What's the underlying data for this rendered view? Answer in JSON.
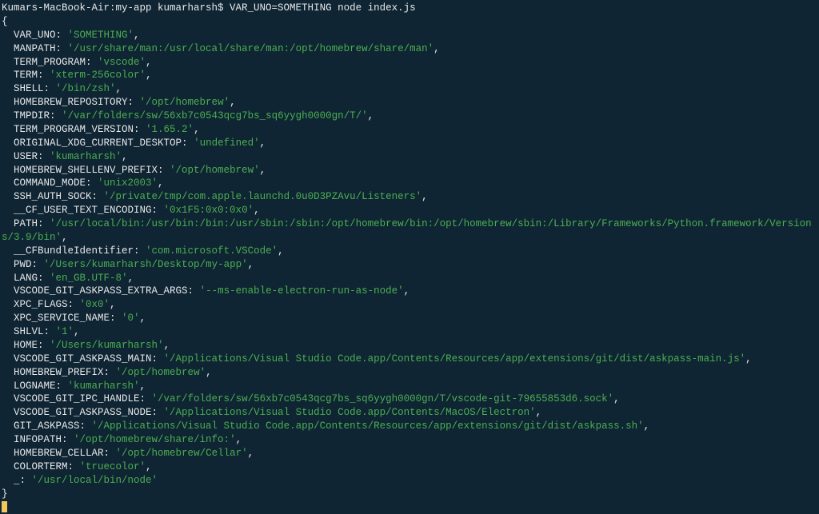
{
  "prompt": "Kumars-MacBook-Air:my-app kumarharsh$ VAR_UNO=SOMETHING node index.js",
  "open_brace": "{",
  "close_brace": "}",
  "env": [
    {
      "key": "VAR_UNO",
      "value": "'SOMETHING'",
      "comma": true
    },
    {
      "key": "MANPATH",
      "value": "'/usr/share/man:/usr/local/share/man:/opt/homebrew/share/man'",
      "comma": true
    },
    {
      "key": "TERM_PROGRAM",
      "value": "'vscode'",
      "comma": true
    },
    {
      "key": "TERM",
      "value": "'xterm-256color'",
      "comma": true
    },
    {
      "key": "SHELL",
      "value": "'/bin/zsh'",
      "comma": true
    },
    {
      "key": "HOMEBREW_REPOSITORY",
      "value": "'/opt/homebrew'",
      "comma": true
    },
    {
      "key": "TMPDIR",
      "value": "'/var/folders/sw/56xb7c0543qcg7bs_sq6yygh0000gn/T/'",
      "comma": true
    },
    {
      "key": "TERM_PROGRAM_VERSION",
      "value": "'1.65.2'",
      "comma": true
    },
    {
      "key": "ORIGINAL_XDG_CURRENT_DESKTOP",
      "value": "'undefined'",
      "comma": true
    },
    {
      "key": "USER",
      "value": "'kumarharsh'",
      "comma": true
    },
    {
      "key": "HOMEBREW_SHELLENV_PREFIX",
      "value": "'/opt/homebrew'",
      "comma": true
    },
    {
      "key": "COMMAND_MODE",
      "value": "'unix2003'",
      "comma": true
    },
    {
      "key": "SSH_AUTH_SOCK",
      "value": "'/private/tmp/com.apple.launchd.0u0D3PZAvu/Listeners'",
      "comma": true
    },
    {
      "key": "__CF_USER_TEXT_ENCODING",
      "value": "'0x1F5:0x0:0x0'",
      "comma": true
    },
    {
      "key": "PATH",
      "value": "'/usr/local/bin:/usr/bin:/bin:/usr/sbin:/sbin:/opt/homebrew/bin:/opt/homebrew/sbin:/Library/Frameworks/Python.framework/Versions/3.9/bin'",
      "comma": true
    },
    {
      "key": "__CFBundleIdentifier",
      "value": "'com.microsoft.VSCode'",
      "comma": true
    },
    {
      "key": "PWD",
      "value": "'/Users/kumarharsh/Desktop/my-app'",
      "comma": true
    },
    {
      "key": "LANG",
      "value": "'en_GB.UTF-8'",
      "comma": true
    },
    {
      "key": "VSCODE_GIT_ASKPASS_EXTRA_ARGS",
      "value": "'--ms-enable-electron-run-as-node'",
      "comma": true
    },
    {
      "key": "XPC_FLAGS",
      "value": "'0x0'",
      "comma": true
    },
    {
      "key": "XPC_SERVICE_NAME",
      "value": "'0'",
      "comma": true
    },
    {
      "key": "SHLVL",
      "value": "'1'",
      "comma": true
    },
    {
      "key": "HOME",
      "value": "'/Users/kumarharsh'",
      "comma": true
    },
    {
      "key": "VSCODE_GIT_ASKPASS_MAIN",
      "value": "'/Applications/Visual Studio Code.app/Contents/Resources/app/extensions/git/dist/askpass-main.js'",
      "comma": true
    },
    {
      "key": "HOMEBREW_PREFIX",
      "value": "'/opt/homebrew'",
      "comma": true
    },
    {
      "key": "LOGNAME",
      "value": "'kumarharsh'",
      "comma": true
    },
    {
      "key": "VSCODE_GIT_IPC_HANDLE",
      "value": "'/var/folders/sw/56xb7c0543qcg7bs_sq6yygh0000gn/T/vscode-git-79655853d6.sock'",
      "comma": true
    },
    {
      "key": "VSCODE_GIT_ASKPASS_NODE",
      "value": "'/Applications/Visual Studio Code.app/Contents/MacOS/Electron'",
      "comma": true
    },
    {
      "key": "GIT_ASKPASS",
      "value": "'/Applications/Visual Studio Code.app/Contents/Resources/app/extensions/git/dist/askpass.sh'",
      "comma": true
    },
    {
      "key": "INFOPATH",
      "value": "'/opt/homebrew/share/info:'",
      "comma": true
    },
    {
      "key": "HOMEBREW_CELLAR",
      "value": "'/opt/homebrew/Cellar'",
      "comma": true
    },
    {
      "key": "COLORTERM",
      "value": "'truecolor'",
      "comma": true
    },
    {
      "key": "_",
      "value": "'/usr/local/bin/node'",
      "comma": false
    }
  ]
}
